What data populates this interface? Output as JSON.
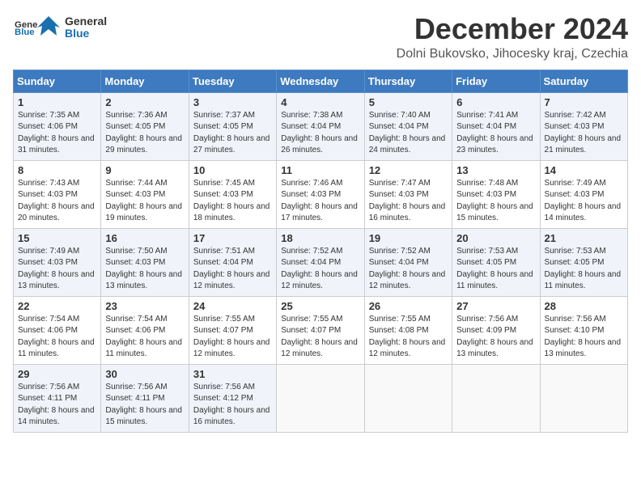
{
  "header": {
    "logo_general": "General",
    "logo_blue": "Blue",
    "month_title": "December 2024",
    "location": "Dolni Bukovsko, Jihocesky kraj, Czechia"
  },
  "columns": [
    "Sunday",
    "Monday",
    "Tuesday",
    "Wednesday",
    "Thursday",
    "Friday",
    "Saturday"
  ],
  "weeks": [
    [
      {
        "day": "1",
        "rise": "7:35 AM",
        "set": "4:06 PM",
        "daylight": "8 hours and 31 minutes."
      },
      {
        "day": "2",
        "rise": "7:36 AM",
        "set": "4:05 PM",
        "daylight": "8 hours and 29 minutes."
      },
      {
        "day": "3",
        "rise": "7:37 AM",
        "set": "4:05 PM",
        "daylight": "8 hours and 27 minutes."
      },
      {
        "day": "4",
        "rise": "7:38 AM",
        "set": "4:04 PM",
        "daylight": "8 hours and 26 minutes."
      },
      {
        "day": "5",
        "rise": "7:40 AM",
        "set": "4:04 PM",
        "daylight": "8 hours and 24 minutes."
      },
      {
        "day": "6",
        "rise": "7:41 AM",
        "set": "4:04 PM",
        "daylight": "8 hours and 23 minutes."
      },
      {
        "day": "7",
        "rise": "7:42 AM",
        "set": "4:03 PM",
        "daylight": "8 hours and 21 minutes."
      }
    ],
    [
      {
        "day": "8",
        "rise": "7:43 AM",
        "set": "4:03 PM",
        "daylight": "8 hours and 20 minutes."
      },
      {
        "day": "9",
        "rise": "7:44 AM",
        "set": "4:03 PM",
        "daylight": "8 hours and 19 minutes."
      },
      {
        "day": "10",
        "rise": "7:45 AM",
        "set": "4:03 PM",
        "daylight": "8 hours and 18 minutes."
      },
      {
        "day": "11",
        "rise": "7:46 AM",
        "set": "4:03 PM",
        "daylight": "8 hours and 17 minutes."
      },
      {
        "day": "12",
        "rise": "7:47 AM",
        "set": "4:03 PM",
        "daylight": "8 hours and 16 minutes."
      },
      {
        "day": "13",
        "rise": "7:48 AM",
        "set": "4:03 PM",
        "daylight": "8 hours and 15 minutes."
      },
      {
        "day": "14",
        "rise": "7:49 AM",
        "set": "4:03 PM",
        "daylight": "8 hours and 14 minutes."
      }
    ],
    [
      {
        "day": "15",
        "rise": "7:49 AM",
        "set": "4:03 PM",
        "daylight": "8 hours and 13 minutes."
      },
      {
        "day": "16",
        "rise": "7:50 AM",
        "set": "4:03 PM",
        "daylight": "8 hours and 13 minutes."
      },
      {
        "day": "17",
        "rise": "7:51 AM",
        "set": "4:04 PM",
        "daylight": "8 hours and 12 minutes."
      },
      {
        "day": "18",
        "rise": "7:52 AM",
        "set": "4:04 PM",
        "daylight": "8 hours and 12 minutes."
      },
      {
        "day": "19",
        "rise": "7:52 AM",
        "set": "4:04 PM",
        "daylight": "8 hours and 12 minutes."
      },
      {
        "day": "20",
        "rise": "7:53 AM",
        "set": "4:05 PM",
        "daylight": "8 hours and 11 minutes."
      },
      {
        "day": "21",
        "rise": "7:53 AM",
        "set": "4:05 PM",
        "daylight": "8 hours and 11 minutes."
      }
    ],
    [
      {
        "day": "22",
        "rise": "7:54 AM",
        "set": "4:06 PM",
        "daylight": "8 hours and 11 minutes."
      },
      {
        "day": "23",
        "rise": "7:54 AM",
        "set": "4:06 PM",
        "daylight": "8 hours and 11 minutes."
      },
      {
        "day": "24",
        "rise": "7:55 AM",
        "set": "4:07 PM",
        "daylight": "8 hours and 12 minutes."
      },
      {
        "day": "25",
        "rise": "7:55 AM",
        "set": "4:07 PM",
        "daylight": "8 hours and 12 minutes."
      },
      {
        "day": "26",
        "rise": "7:55 AM",
        "set": "4:08 PM",
        "daylight": "8 hours and 12 minutes."
      },
      {
        "day": "27",
        "rise": "7:56 AM",
        "set": "4:09 PM",
        "daylight": "8 hours and 13 minutes."
      },
      {
        "day": "28",
        "rise": "7:56 AM",
        "set": "4:10 PM",
        "daylight": "8 hours and 13 minutes."
      }
    ],
    [
      {
        "day": "29",
        "rise": "7:56 AM",
        "set": "4:11 PM",
        "daylight": "8 hours and 14 minutes."
      },
      {
        "day": "30",
        "rise": "7:56 AM",
        "set": "4:11 PM",
        "daylight": "8 hours and 15 minutes."
      },
      {
        "day": "31",
        "rise": "7:56 AM",
        "set": "4:12 PM",
        "daylight": "8 hours and 16 minutes."
      },
      null,
      null,
      null,
      null
    ]
  ]
}
